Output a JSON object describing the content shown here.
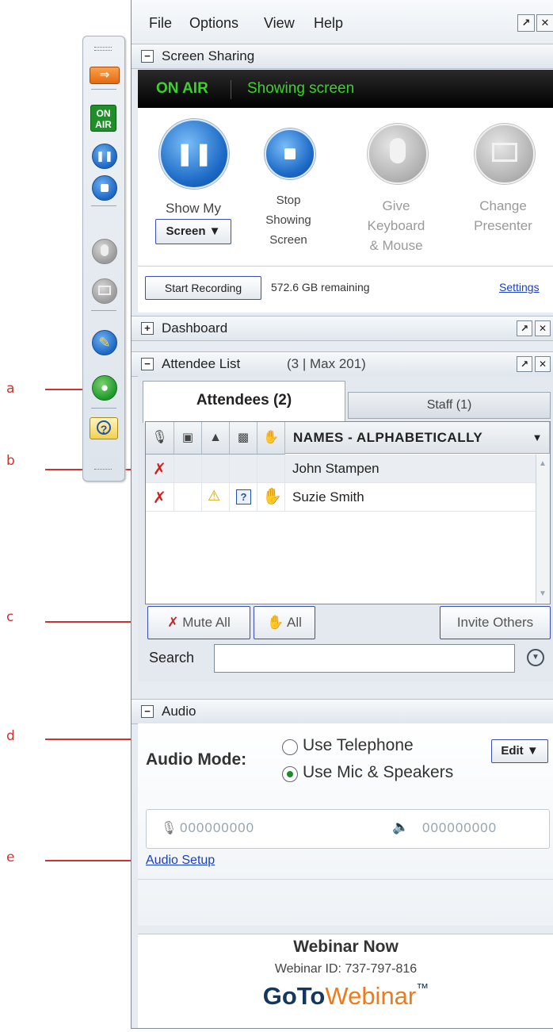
{
  "callouts": [
    "a",
    "b",
    "c",
    "d",
    "e"
  ],
  "toolbar": {
    "on_air_label_top": "ON",
    "on_air_label_bottom": "AIR"
  },
  "menu": [
    "File",
    "Options",
    "View",
    "Help"
  ],
  "screen_sharing": {
    "title": "Screen Sharing",
    "on_air": "ON AIR",
    "status": "Showing screen",
    "show_my_label": "Show My",
    "screen_dropdown": "Screen ▼",
    "stop_label_1": "Stop",
    "stop_label_2": "Showing",
    "stop_label_3": "Screen",
    "give_label_1": "Give",
    "give_label_2": "Keyboard",
    "give_label_3": "& Mouse",
    "change_label_1": "Change",
    "change_label_2": "Presenter",
    "start_recording": "Start Recording",
    "remaining": "572.6 GB remaining",
    "settings_link": "Settings"
  },
  "dashboard": {
    "title": "Dashboard"
  },
  "attendee_list": {
    "title": "Attendee List",
    "count": "(3 | Max 201)",
    "tab_attendees": "Attendees (2)",
    "tab_staff": "Staff (1)",
    "names_header": "NAMES - ALPHABETICALLY",
    "rows": [
      {
        "name": "John Stampen"
      },
      {
        "name": "Suzie Smith"
      }
    ],
    "mute_all": "Mute All",
    "hand_all": "All",
    "invite_others": "Invite Others",
    "search_label": "Search"
  },
  "audio": {
    "title": "Audio",
    "mode_label": "Audio Mode:",
    "option_telephone": "Use Telephone",
    "option_mic": "Use Mic & Speakers",
    "edit_button": "Edit ▼",
    "mic_level": "000000000",
    "speaker_level": "000000000",
    "setup_link": "Audio Setup"
  },
  "footer": {
    "webinar_title": "Webinar Now",
    "webinar_id": "Webinar ID: 737-797-816",
    "brand_bold": "GoTo",
    "brand_light": "Webinar",
    "brand_tm": "™"
  },
  "colors": {
    "callout": "#cc3333",
    "on_air_green": "#3bd22a",
    "link_blue": "#1a3fc2",
    "button_border": "#3b4db8"
  }
}
